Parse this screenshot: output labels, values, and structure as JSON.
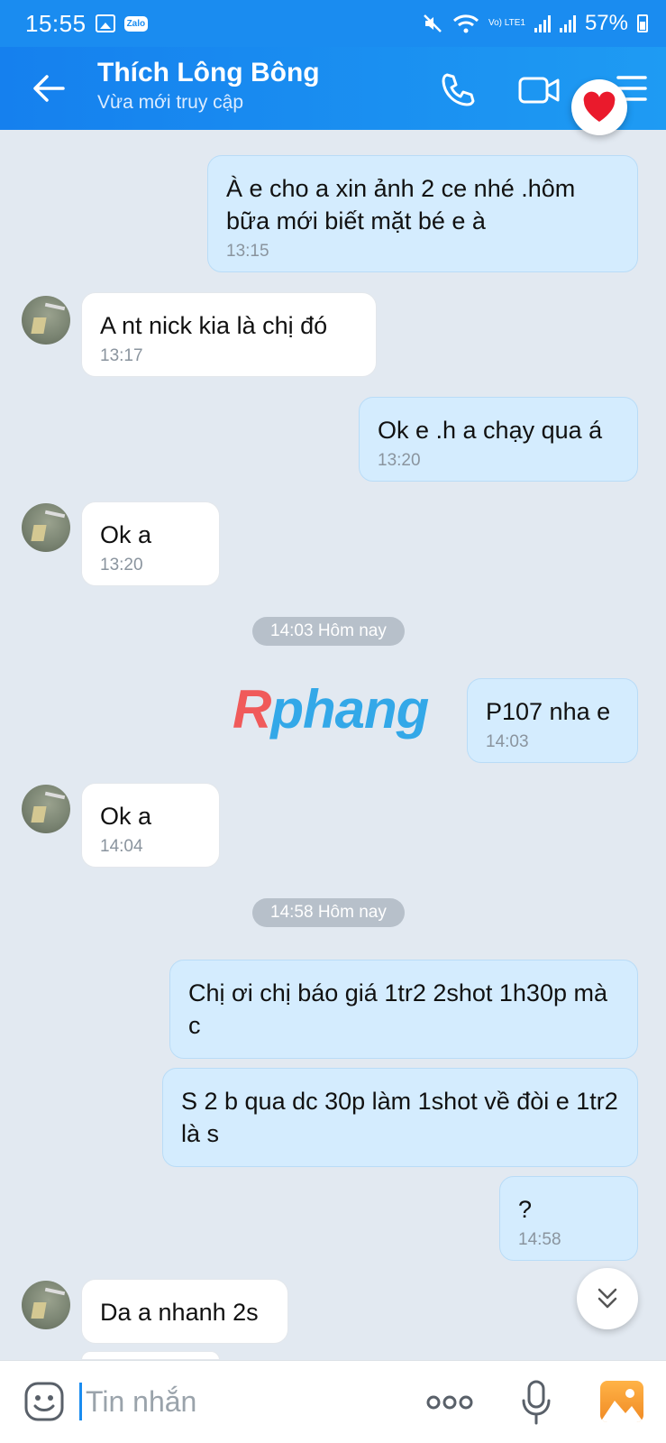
{
  "status_bar": {
    "time": "15:55",
    "app_badge": "Zalo",
    "network_label": "Vo) LTE1",
    "battery": "57%"
  },
  "header": {
    "title": "Thích Lông Bông",
    "subtitle": "Vừa mới truy cập",
    "accent": "#1a8cf0"
  },
  "messages": [
    {
      "text": "À e cho a xin ảnh 2 ce nhé .hôm bữa mới biết mặt bé e à",
      "time": "13:15"
    },
    {
      "text": "A nt nick kia là chị đó",
      "time": "13:17"
    },
    {
      "text": "Ok e .h a chạy qua á",
      "time": "13:20"
    },
    {
      "text": "Ok a",
      "time": "13:20"
    },
    {
      "text": "P107 nha e",
      "time": "14:03"
    },
    {
      "text": "Ok a",
      "time": "14:04"
    },
    {
      "text": "Chị ơi chị báo giá 1tr2 2shot 1h30p mà c",
      "time": ""
    },
    {
      "text": "S 2 b qua dc 30p làm 1shot về đòi e 1tr2 là s",
      "time": ""
    },
    {
      "text": "?",
      "time": "14:58"
    },
    {
      "text": "Da a nhanh 2s",
      "time": ""
    }
  ],
  "separators": [
    "14:03 Hôm nay",
    "14:58 Hôm nay"
  ],
  "watermark": {
    "first": "R",
    "rest": "phang"
  },
  "composer": {
    "placeholder": "Tin nhắn"
  },
  "icons": [
    "back-arrow-icon",
    "phone-icon",
    "video-call-icon",
    "menu-icon",
    "heart-icon",
    "chevron-down-icon",
    "emoji-icon",
    "more-icon",
    "mic-icon",
    "gallery-icon"
  ]
}
